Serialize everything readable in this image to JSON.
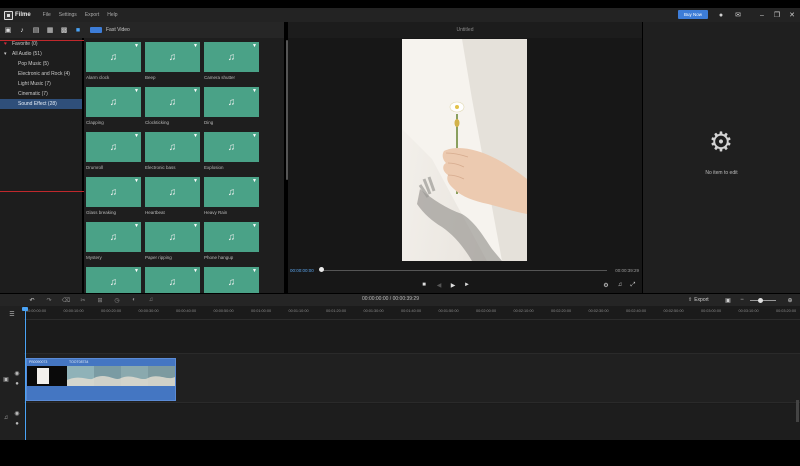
{
  "app": {
    "name": "Filme",
    "menu": [
      "File",
      "Settings",
      "Export",
      "Help"
    ],
    "buy_label": "Buy Now"
  },
  "library": {
    "header_label": "Fast Video",
    "tree": [
      {
        "label": "Favorite (0)",
        "level": 0,
        "marker": "heart"
      },
      {
        "label": "All Audio (51)",
        "level": 0,
        "marker": "triangle"
      },
      {
        "label": "Pop Music (5)",
        "level": 1
      },
      {
        "label": "Electronic and Rock (4)",
        "level": 1
      },
      {
        "label": "Light Music (7)",
        "level": 1
      },
      {
        "label": "Cinematic (7)",
        "level": 1
      },
      {
        "label": "Sound Effect (28)",
        "level": 1,
        "selected": true
      }
    ],
    "items": [
      "Alarm clock",
      "Beep",
      "Camera shutter",
      "Clapping",
      "Clockticking",
      "Ding",
      "Drumroll",
      "Electronic bass",
      "Explosion",
      "Glass breaking",
      "Heartbeat",
      "Heavy Rain",
      "Mystery",
      "Paper ripping",
      "Phone hangup",
      "",
      "",
      ""
    ]
  },
  "preview": {
    "title": "Untitled",
    "current_time": "00:00:00:00",
    "total_time": "00:00:39:29"
  },
  "properties": {
    "empty_text": "No item to edit"
  },
  "timeline": {
    "timecode": "00:00:00:00 / 00:00:39:29",
    "export_label": "Export",
    "ruler": [
      "00:00:00:00",
      "00:00:10:00",
      "00:00:20:00",
      "00:00:30:00",
      "00:00:40:00",
      "00:00:50:00",
      "00:01:00:00",
      "00:01:10:00",
      "00:01:20:00",
      "00:01:30:00",
      "00:01:40:00",
      "00:01:50:00",
      "00:02:00:00",
      "00:02:10:00",
      "00:02:20:00",
      "00:02:30:00",
      "00:02:40:00",
      "00:02:50:00",
      "00:03:00:00",
      "00:03:10:00",
      "00:03:20:00"
    ],
    "clips": [
      "PB0090073",
      "TOOT08734"
    ]
  },
  "colors": {
    "accent": "#3d7dd8",
    "thumb": "#4aa287",
    "clip": "#4476c2",
    "highlight": "#c0282c"
  }
}
